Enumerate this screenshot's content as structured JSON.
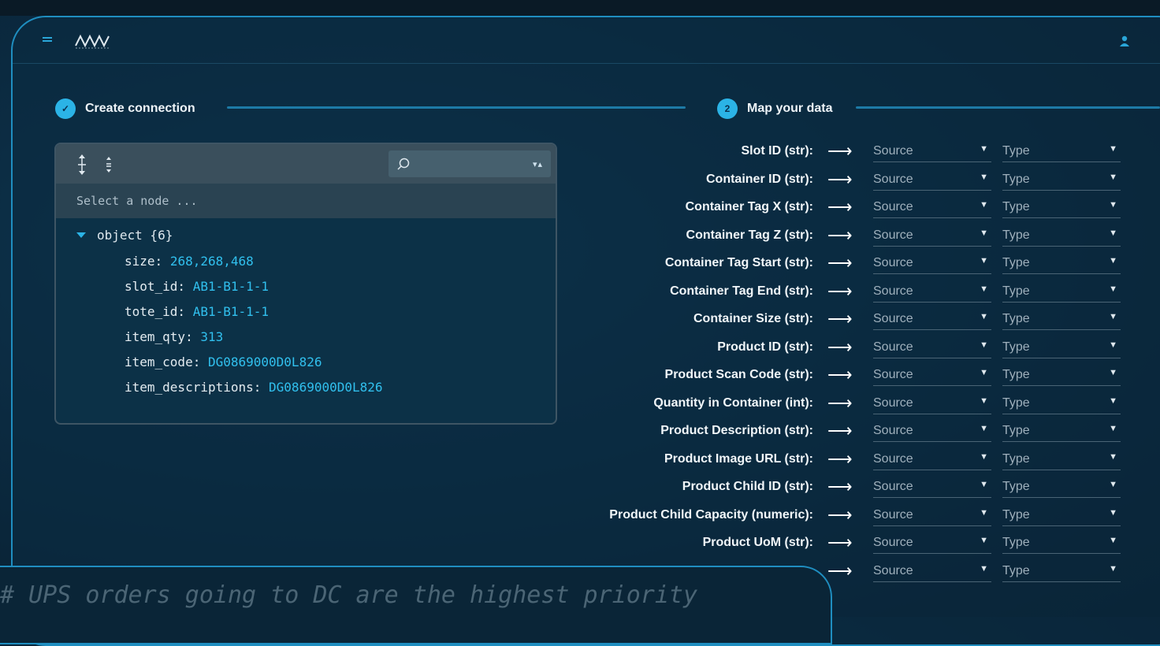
{
  "header": {
    "menu_icon": "hamburger-icon",
    "logo_icon": "brand-logo",
    "user_icon": "user-icon"
  },
  "steps": [
    {
      "badge": "✓",
      "label": "Create connection",
      "state": "complete"
    },
    {
      "badge": "2",
      "label": "Map your data",
      "state": "active"
    }
  ],
  "json_panel": {
    "placeholder": "Select a node ...",
    "root_label": "object {6}",
    "fields": [
      {
        "key": "size:",
        "value": "268,268,468"
      },
      {
        "key": "slot_id:",
        "value": "AB1-B1-1-1"
      },
      {
        "key": "tote_id:",
        "value": "AB1-B1-1-1"
      },
      {
        "key": "item_qty:",
        "value": "313"
      },
      {
        "key": "item_code:",
        "value": "DG0869000D0L826"
      },
      {
        "key": "item_descriptions:",
        "value": "DG0869000D0L826"
      }
    ],
    "search_caret": "▾▴"
  },
  "mapping": {
    "arrow": "⟶",
    "source_placeholder": "Source",
    "type_placeholder": "Type",
    "caret": "▼",
    "rows": [
      "Slot ID (str):",
      "Container ID (str):",
      "Container Tag X (str):",
      "Container Tag Z (str):",
      "Container Tag Start (str):",
      "Container Tag End (str):",
      "Container Size (str):",
      "Product ID (str):",
      "Product Scan Code (str):",
      "Quantity in Container (int):",
      "Product Description (str):",
      "Product Image URL (str):",
      "Product Child ID (str):",
      "Product Child Capacity (numeric):",
      "Product UoM (str):",
      ""
    ]
  },
  "prompt": {
    "text": "# UPS orders going to DC are the highest priority"
  },
  "colors": {
    "accent": "#2bb3e6",
    "value": "#31c0ee",
    "frame": "#1f8ec0"
  }
}
